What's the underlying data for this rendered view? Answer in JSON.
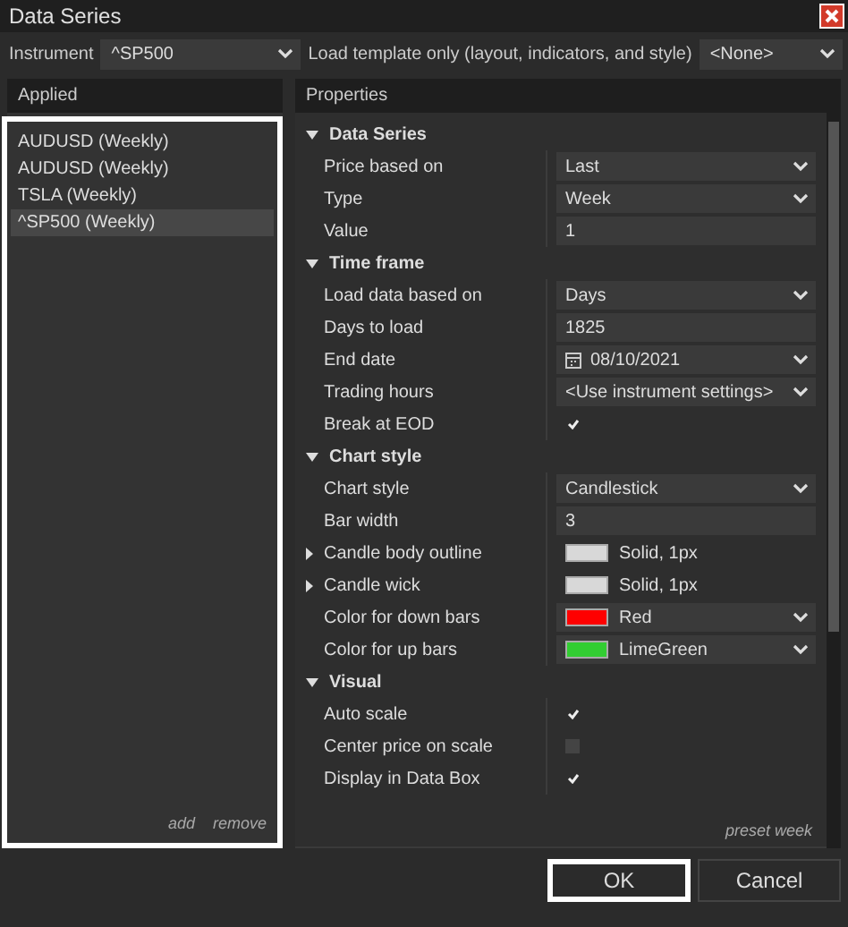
{
  "window": {
    "title": "Data Series"
  },
  "instrument": {
    "label": "Instrument",
    "value": "^SP500"
  },
  "template": {
    "label": "Load template only (layout, indicators, and style)",
    "value": "<None>"
  },
  "applied": {
    "header": "Applied",
    "highlighted": true,
    "items": [
      {
        "label": "AUDUSD (Weekly)",
        "selected": false
      },
      {
        "label": "AUDUSD (Weekly)",
        "selected": false
      },
      {
        "label": "TSLA (Weekly)",
        "selected": false
      },
      {
        "label": "^SP500 (Weekly)",
        "selected": true
      }
    ],
    "actions": [
      "add",
      "remove"
    ]
  },
  "properties": {
    "header": "Properties",
    "footer": "preset week",
    "rows": [
      {
        "kind": "category",
        "label": "Data Series",
        "expanded": true
      },
      {
        "kind": "dropdown",
        "label": "Price based on",
        "value": "Last"
      },
      {
        "kind": "dropdown",
        "label": "Type",
        "value": "Week"
      },
      {
        "kind": "text",
        "label": "Value",
        "value": "1"
      },
      {
        "kind": "category",
        "label": "Time frame",
        "expanded": true
      },
      {
        "kind": "dropdown",
        "label": "Load data based on",
        "value": "Days"
      },
      {
        "kind": "text",
        "label": "Days to load",
        "value": "1825"
      },
      {
        "kind": "date",
        "label": "End date",
        "value": "08/10/2021"
      },
      {
        "kind": "dropdown",
        "label": "Trading hours",
        "value": "<Use instrument settings>"
      },
      {
        "kind": "check",
        "label": "Break at EOD",
        "checked": true
      },
      {
        "kind": "category",
        "label": "Chart style",
        "expanded": true
      },
      {
        "kind": "dropdown",
        "label": "Chart style",
        "value": "Candlestick"
      },
      {
        "kind": "text",
        "label": "Bar width",
        "value": "3"
      },
      {
        "kind": "stroke",
        "label": "Candle body outline",
        "value": "Solid, 1px",
        "color": "#d8d8d8",
        "expanded": false
      },
      {
        "kind": "stroke",
        "label": "Candle wick",
        "value": "Solid, 1px",
        "color": "#d8d8d8",
        "expanded": false
      },
      {
        "kind": "color",
        "label": "Color for down bars",
        "value": "Red",
        "color": "#ff0000"
      },
      {
        "kind": "color",
        "label": "Color for up bars",
        "value": "LimeGreen",
        "color": "#32cd32"
      },
      {
        "kind": "category",
        "label": "Visual",
        "expanded": true
      },
      {
        "kind": "check",
        "label": "Auto scale",
        "checked": true
      },
      {
        "kind": "check",
        "label": "Center price on scale",
        "checked": false
      },
      {
        "kind": "check",
        "label": "Display in Data Box",
        "checked": true
      }
    ]
  },
  "buttons": [
    {
      "label": "OK",
      "highlighted": true
    },
    {
      "label": "Cancel",
      "highlighted": false
    }
  ]
}
